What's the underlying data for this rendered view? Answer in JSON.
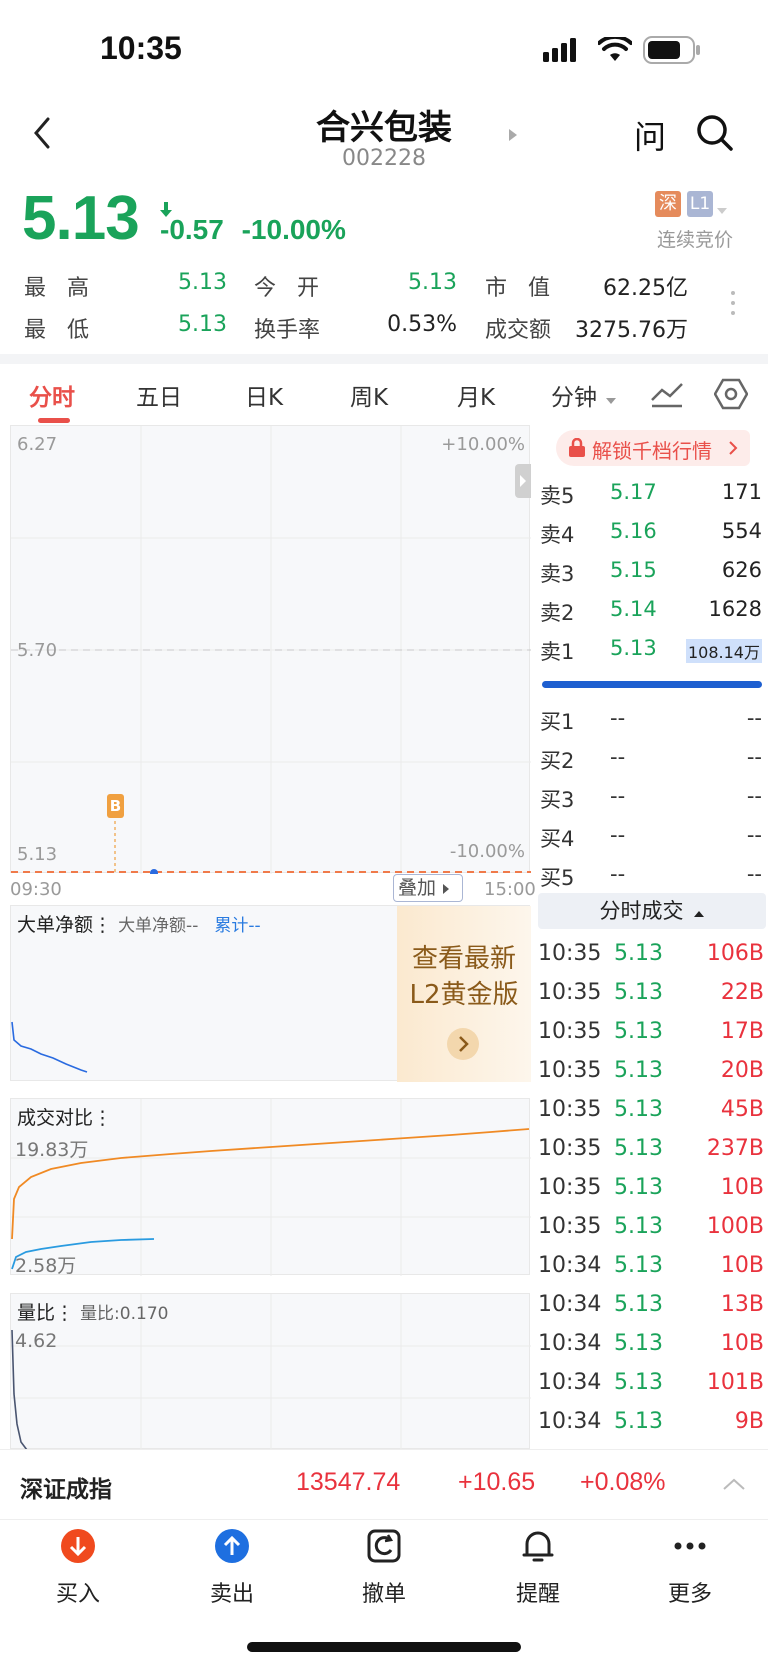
{
  "status_bar": {
    "time": "10:35"
  },
  "header": {
    "title": "合兴包装",
    "code": "002228",
    "ask_label": "问"
  },
  "quote": {
    "price": "5.13",
    "change": "-0.57",
    "change_pct": "-10.00%",
    "market_badge": "深",
    "level_badge": "L1",
    "trading_status": "连续竞价"
  },
  "stats": [
    {
      "label": "最 高",
      "value": "5.13",
      "color": "#1aa35a"
    },
    {
      "label": "今 开",
      "value": "5.13",
      "color": "#1aa35a"
    },
    {
      "label": "市 值",
      "value": "62.25亿",
      "color": "#222222"
    },
    {
      "label": "最 低",
      "value": "5.13",
      "color": "#1aa35a"
    },
    {
      "label": "换手率",
      "value": "0.53%",
      "color": "#222222"
    },
    {
      "label": "成交额",
      "value": "3275.76万",
      "color": "#222222"
    }
  ],
  "tabs": [
    "分时",
    "五日",
    "日K",
    "周K",
    "月K",
    "分钟"
  ],
  "chart": {
    "price_top": "6.27",
    "pct_top": "+10.00%",
    "price_mid": "5.70",
    "price_bottom": "5.13",
    "pct_bottom": "-10.00%",
    "time_start": "09:30",
    "time_end": "15:00",
    "overlay_label": "叠加",
    "marker_label": "B"
  },
  "big_order": {
    "title": "大单净额",
    "subtitle": "大单净额--",
    "cumulative": "累计--"
  },
  "l2_promo": {
    "line1": "查看最新",
    "line2": "L2黄金版"
  },
  "volume_compare": {
    "title": "成交对比",
    "top_value": "19.83万",
    "bottom_value": "2.58万"
  },
  "volume_ratio": {
    "title": "量比",
    "subtitle": "量比:0.170",
    "top_value": "4.62"
  },
  "unlock_label": "解锁千档行情",
  "order_book": {
    "sells": [
      {
        "label": "卖5",
        "price": "5.17",
        "volume": "171"
      },
      {
        "label": "卖4",
        "price": "5.16",
        "volume": "554"
      },
      {
        "label": "卖3",
        "price": "5.15",
        "volume": "626"
      },
      {
        "label": "卖2",
        "price": "5.14",
        "volume": "1628"
      },
      {
        "label": "卖1",
        "price": "5.13",
        "volume": "108.14万"
      }
    ],
    "buys": [
      {
        "label": "买1",
        "price": "--",
        "volume": "--"
      },
      {
        "label": "买2",
        "price": "--",
        "volume": "--"
      },
      {
        "label": "买3",
        "price": "--",
        "volume": "--"
      },
      {
        "label": "买4",
        "price": "--",
        "volume": "--"
      },
      {
        "label": "买5",
        "price": "--",
        "volume": "--"
      }
    ]
  },
  "ticks_header": "分时成交",
  "ticks": [
    {
      "time": "10:35",
      "price": "5.13",
      "vol": "106B"
    },
    {
      "time": "10:35",
      "price": "5.13",
      "vol": "22B"
    },
    {
      "time": "10:35",
      "price": "5.13",
      "vol": "17B"
    },
    {
      "time": "10:35",
      "price": "5.13",
      "vol": "20B"
    },
    {
      "time": "10:35",
      "price": "5.13",
      "vol": "45B"
    },
    {
      "time": "10:35",
      "price": "5.13",
      "vol": "237B"
    },
    {
      "time": "10:35",
      "price": "5.13",
      "vol": "10B"
    },
    {
      "time": "10:35",
      "price": "5.13",
      "vol": "100B"
    },
    {
      "time": "10:34",
      "price": "5.13",
      "vol": "10B"
    },
    {
      "time": "10:34",
      "price": "5.13",
      "vol": "13B"
    },
    {
      "time": "10:34",
      "price": "5.13",
      "vol": "10B"
    },
    {
      "time": "10:34",
      "price": "5.13",
      "vol": "101B"
    },
    {
      "time": "10:34",
      "price": "5.13",
      "vol": "9B"
    }
  ],
  "index_bar": {
    "name": "深证成指",
    "value": "13547.74",
    "change": "+10.65",
    "change_pct": "+0.08%"
  },
  "bottom_nav": [
    {
      "label": "买入",
      "icon": "buy-icon"
    },
    {
      "label": "卖出",
      "icon": "sell-icon"
    },
    {
      "label": "撤单",
      "icon": "cancel-order-icon"
    },
    {
      "label": "提醒",
      "icon": "bell-icon"
    },
    {
      "label": "更多",
      "icon": "more-icon"
    }
  ],
  "colors": {
    "up": "#e9323d",
    "down": "#1aa35a",
    "accent": "#e9504a",
    "series_orange": "#f08a24",
    "series_blue": "#2a9be0"
  }
}
